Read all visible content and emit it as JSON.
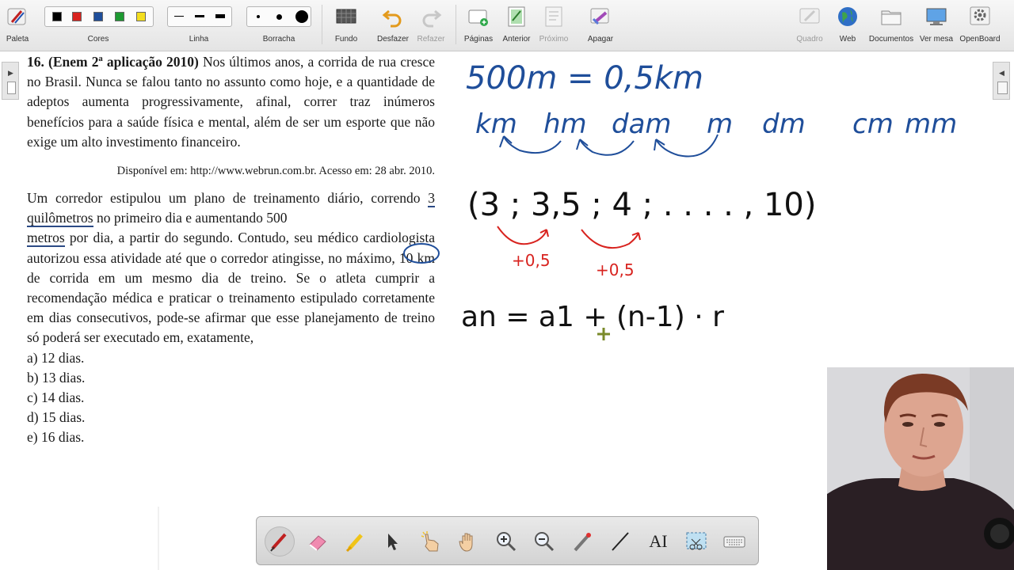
{
  "toolbar": {
    "items": [
      {
        "label": "Paleta"
      },
      {
        "label": "Cores"
      },
      {
        "label": "Linha"
      },
      {
        "label": "Borracha"
      },
      {
        "label": "Fundo"
      },
      {
        "label": "Desfazer"
      },
      {
        "label": "Refazer"
      },
      {
        "label": "Páginas"
      },
      {
        "label": "Anterior"
      },
      {
        "label": "Próximo"
      },
      {
        "label": "Apagar"
      },
      {
        "label": "Quadro"
      },
      {
        "label": "Web"
      },
      {
        "label": "Documentos"
      },
      {
        "label": "Ver mesa"
      },
      {
        "label": "OpenBoard"
      }
    ],
    "colors": [
      "#000000",
      "#d8231f",
      "#1f4e9a",
      "#1e9a32",
      "#f3de1f"
    ]
  },
  "question": {
    "heading": "16. (Enem 2ª aplicação 2010)",
    "intro": " Nos últimos anos, a corrida de rua cresce no Brasil. Nunca se falou tanto no assunto como hoje, e a quantidade de adeptos aumenta progressivamente, afinal, correr traz inúmeros benefícios para a saúde física e mental, além de ser um esporte que não exige um alto investimento financeiro.",
    "source": "Disponível em: http://www.webrun.com.br. Acesso em: 28 abr. 2010.",
    "body_1": "Um corredor estipulou um plano de treinamento diário, correndo ",
    "body_underline_1": "3 quilômetros",
    "body_2": " no primeiro dia e aumentando ",
    "body_circled": "500",
    "body_3": " ",
    "body_underline_2": "metros",
    "body_4": " por dia, a partir do segundo. Contudo, seu médico cardiologista autorizou essa atividade até que o corredor atingisse, no máximo, 10 km de corrida em um mesmo dia de treino. Se o atleta cumprir a recomendação médica e praticar o treinamento estipulado corretamente em dias consecutivos, pode-se afirmar que esse planejamento de treino só poderá ser executado em, exatamente,",
    "options": [
      "a) 12 dias.",
      "b) 13 dias.",
      "c) 14 dias.",
      "d) 15 dias.",
      "e) 16 dias."
    ]
  },
  "handwriting": {
    "line1": "500m = 0,5km",
    "line2": [
      "km",
      "hm",
      "dam",
      "m",
      "dm",
      "cm",
      "mm"
    ],
    "line3": "(3 ; 3,5 ; 4 ; . . . . , 10)",
    "step_label": "+0,5",
    "line4": "an = a1 + (n-1) · r"
  },
  "ink_colors": {
    "blue": "#1f4e9a",
    "black": "#111111",
    "red": "#d8231f"
  }
}
